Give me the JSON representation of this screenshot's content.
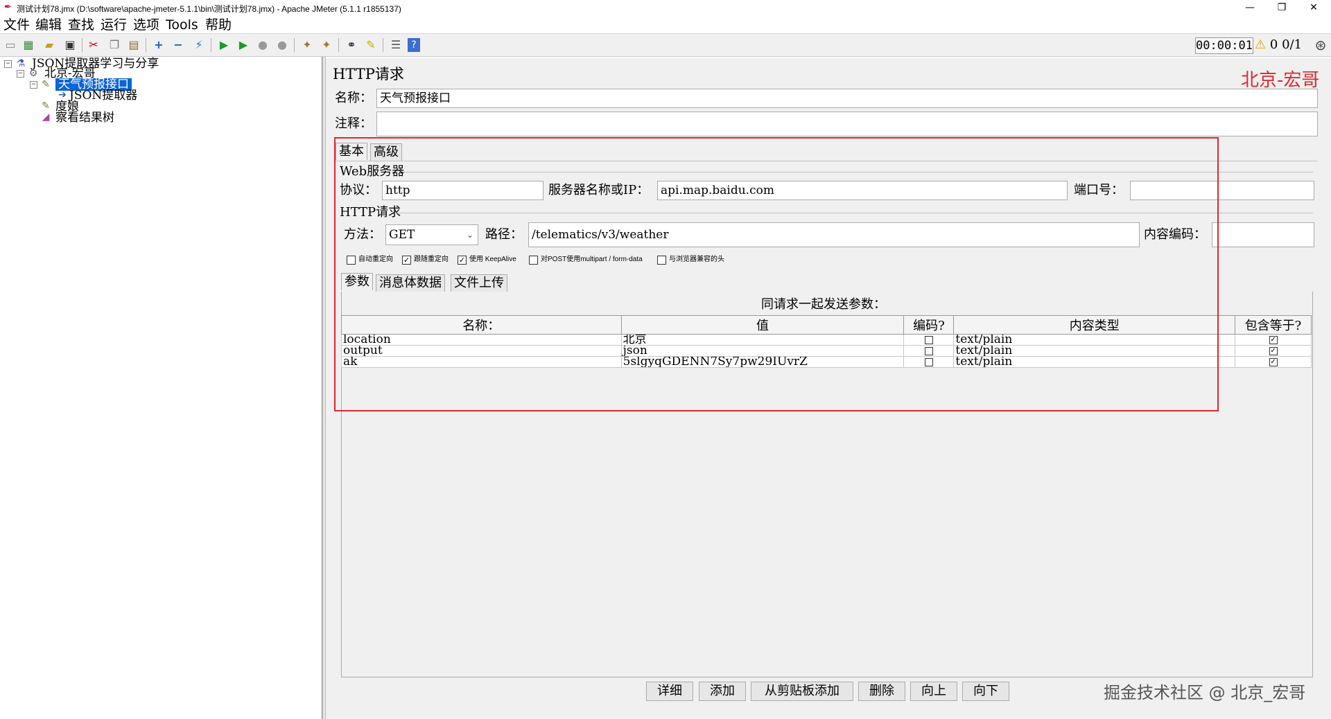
{
  "window": {
    "title": "测试计划78.jmx (D:\\software\\apache-jmeter-5.1.1\\bin\\测试计划78.jmx) - Apache JMeter (5.1.1 r1855137)",
    "minimize": "—",
    "maximize": "❐",
    "close": "✕"
  },
  "menu": [
    "文件",
    "编辑",
    "查找",
    "运行",
    "选项",
    "Tools",
    "帮助"
  ],
  "toolbar": {
    "timer": "00:00:01",
    "warning_count": "0",
    "threads": "0/1",
    "icons": [
      "new-icon",
      "templates-icon",
      "open-icon",
      "save-icon",
      "cut-icon",
      "copy-icon",
      "paste-icon",
      "expand-icon",
      "collapse-icon",
      "toggle-icon",
      "start-icon",
      "start-no-pause-icon",
      "stop-icon",
      "shutdown-icon",
      "clear-icon",
      "clear-all-icon",
      "search-icon",
      "reset-search-icon",
      "function-helper-icon",
      "help-icon"
    ]
  },
  "tree": {
    "nodes": [
      {
        "label": "JSON提取器学习与分享",
        "icon": "test-plan-icon"
      },
      {
        "label": "北京-宏哥",
        "icon": "thread-group-icon"
      },
      {
        "label": "天气预报接口",
        "icon": "http-sampler-icon"
      },
      {
        "label": "JSON提取器",
        "icon": "json-extractor-icon"
      },
      {
        "label": "度娘",
        "icon": "http-sampler-icon"
      },
      {
        "label": "察看结果树",
        "icon": "listener-icon"
      }
    ]
  },
  "panel": {
    "title": "HTTP请求",
    "name_label": "名称：",
    "name_value": "天气预报接口",
    "comment_label": "注释：",
    "comment_value": "",
    "tabs": [
      "基本",
      "高级"
    ],
    "web_server": {
      "group": "Web服务器",
      "protocol_label": "协议：",
      "protocol_value": "http",
      "server_label": "服务器名称或IP：",
      "server_value": "api.map.baidu.com",
      "port_label": "端口号：",
      "port_value": ""
    },
    "http_request": {
      "group": "HTTP请求",
      "method_label": "方法：",
      "method_value": "GET",
      "path_label": "路径：",
      "path_value": "/telematics/v3/weather",
      "encoding_label": "内容编码：",
      "encoding_value": ""
    },
    "checkboxes": [
      {
        "label": "自动重定向",
        "checked": false
      },
      {
        "label": "跟随重定向",
        "checked": true
      },
      {
        "label": "使用 KeepAlive",
        "checked": true
      },
      {
        "label": "对POST使用multipart / form-data",
        "checked": false
      },
      {
        "label": "与浏览器兼容的头",
        "checked": false
      }
    ],
    "subtabs": [
      "参数",
      "消息体数据",
      "文件上传"
    ],
    "params_caption": "同请求一起发送参数：",
    "columns": [
      "名称：",
      "值",
      "编码?",
      "内容类型",
      "包含等于?"
    ],
    "rows": [
      {
        "name": "location",
        "value": "北京",
        "encode": false,
        "content_type": "text/plain",
        "include_equals": true
      },
      {
        "name": "output",
        "value": "json",
        "encode": false,
        "content_type": "text/plain",
        "include_equals": true
      },
      {
        "name": "ak",
        "value": "5slgyqGDENN7Sy7pw29IUvrZ",
        "encode": false,
        "content_type": "text/plain",
        "include_equals": true
      }
    ],
    "buttons": [
      "详细",
      "添加",
      "从剪贴板添加",
      "删除",
      "向上",
      "向下"
    ]
  },
  "brand_text": "北京-宏哥",
  "watermark": "掘金技术社区 @ 北京_宏哥",
  "colors": {
    "highlight": "#e0262c",
    "selection": "#0a64d6"
  }
}
